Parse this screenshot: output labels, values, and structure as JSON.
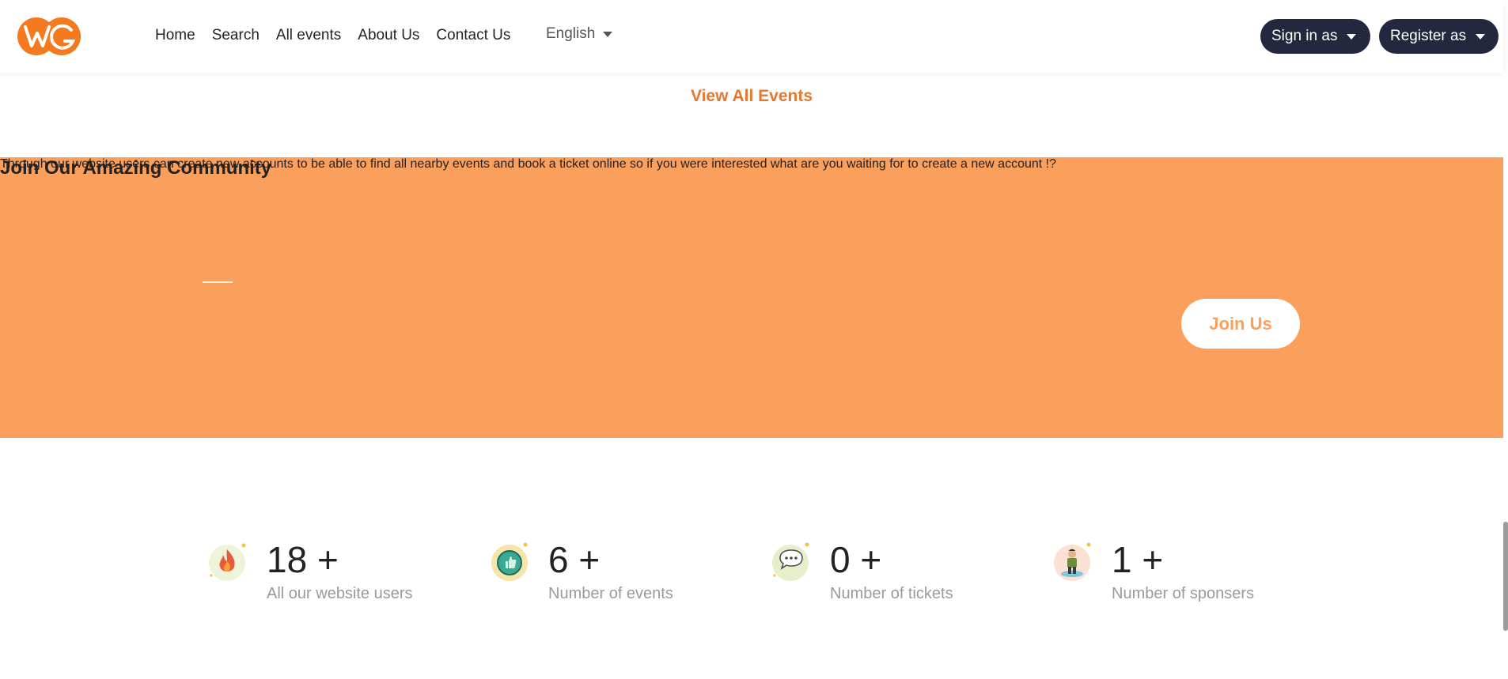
{
  "nav": {
    "links": [
      "Home",
      "Search",
      "All events",
      "About Us",
      "Contact Us"
    ],
    "language": "English",
    "signin_label": "Sign in as",
    "register_label": "Register as"
  },
  "view_all_label": "View All Events",
  "community": {
    "title": "Join Our Amazing Community",
    "description": "Through our website users can create new accounts to be able to find all nearby events and book a ticket online so if you were interested what are you waiting for to create a new account !?",
    "join_label": "Join Us"
  },
  "stats": [
    {
      "value": "18 +",
      "label": "All our website users",
      "icon": "flame-icon"
    },
    {
      "value": "6 +",
      "label": "Number of events",
      "icon": "thumbs-up-icon"
    },
    {
      "value": "0 +",
      "label": "Number of tickets",
      "icon": "chat-bubble-icon"
    },
    {
      "value": "1 +",
      "label": "Number of sponsers",
      "icon": "person-icon"
    }
  ],
  "colors": {
    "accent": "#e8772e",
    "band": "#fb9f5d",
    "dark_button": "#23283f"
  }
}
